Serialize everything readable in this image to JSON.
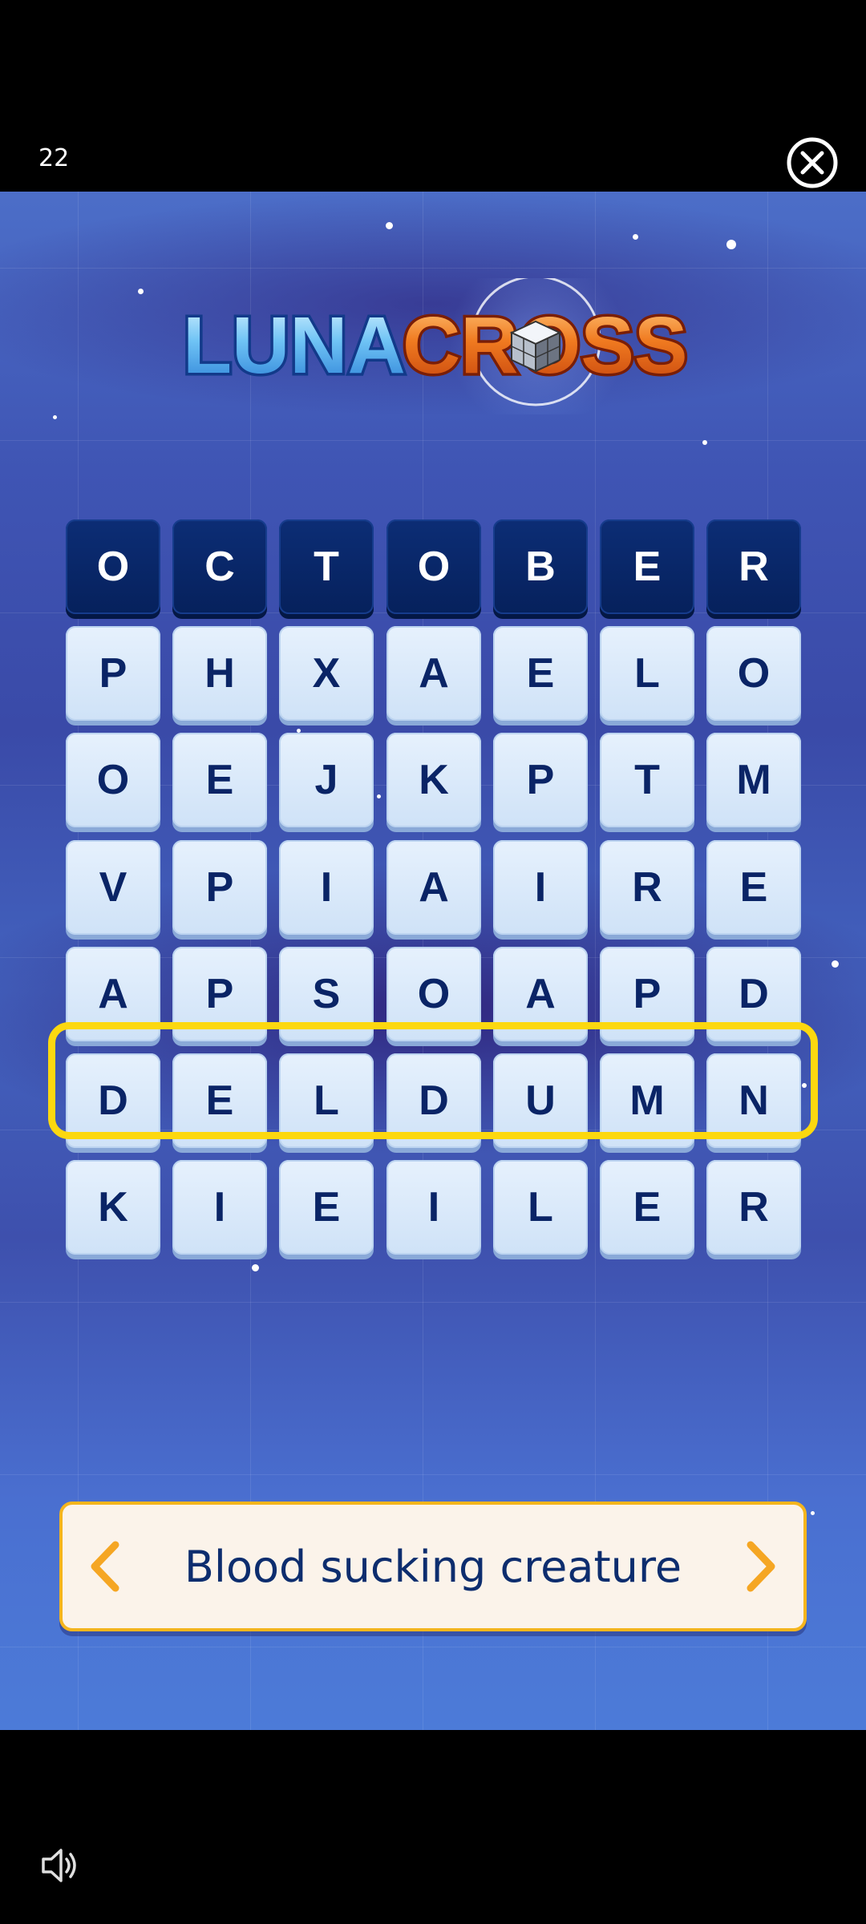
{
  "status": {
    "level": "22"
  },
  "logo": {
    "luna": "LUNA",
    "cross": "CROSS"
  },
  "board": {
    "rows": [
      [
        "O",
        "C",
        "T",
        "O",
        "B",
        "E",
        "R"
      ],
      [
        "P",
        "H",
        "X",
        "A",
        "E",
        "L",
        "O"
      ],
      [
        "O",
        "E",
        "J",
        "K",
        "P",
        "T",
        "M"
      ],
      [
        "V",
        "P",
        "I",
        "A",
        "I",
        "R",
        "E"
      ],
      [
        "A",
        "P",
        "S",
        "O",
        "A",
        "P",
        "D"
      ],
      [
        "D",
        "E",
        "L",
        "D",
        "U",
        "M",
        "N"
      ],
      [
        "K",
        "I",
        "E",
        "I",
        "L",
        "E",
        "R"
      ]
    ],
    "header_row_index": 0,
    "highlighted_row_index": 3
  },
  "clue": {
    "text": "Blood sucking creature"
  },
  "icons": {
    "close": "close-circle-icon",
    "prev": "chevron-left-icon",
    "next": "chevron-right-icon",
    "sound": "speaker-icon"
  },
  "colors": {
    "header_tile": "#0a2a6e",
    "letter_tile": "#dbeafb",
    "highlight": "#fcd80f",
    "clue_border": "#f5b51d",
    "arrow": "#f5a623"
  }
}
